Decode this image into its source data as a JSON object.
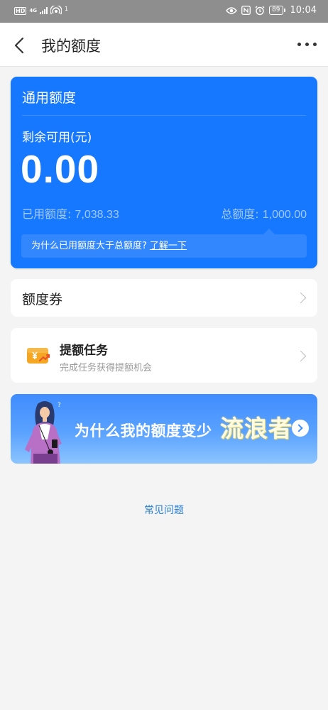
{
  "status_bar": {
    "hd": "HD",
    "network": "4G",
    "wifi_count": "1",
    "battery": "89",
    "time": "10:04"
  },
  "nav": {
    "title": "我的额度"
  },
  "credit": {
    "section_title": "通用额度",
    "remaining_label": "剩余可用(元)",
    "remaining_amount": "0.00",
    "used_label": "已用额度:",
    "used_value": "7,038.33",
    "total_label": "总额度:",
    "total_value": "1,000.00",
    "tip_question": "为什么已用额度大于总额度?",
    "tip_link": "了解一下"
  },
  "voucher": {
    "label": "额度券"
  },
  "task": {
    "title": "提额任务",
    "subtitle": "完成任务获得提额机会"
  },
  "banner": {
    "text": "为什么我的额度变少",
    "watermark": "流浪者"
  },
  "footer": {
    "faq": "常见问题"
  },
  "colors": {
    "primary_blue": "#1677ff",
    "link_blue": "#2a7fd4",
    "background": "#f4f4f4",
    "status_bar": "#8e8e8e"
  }
}
